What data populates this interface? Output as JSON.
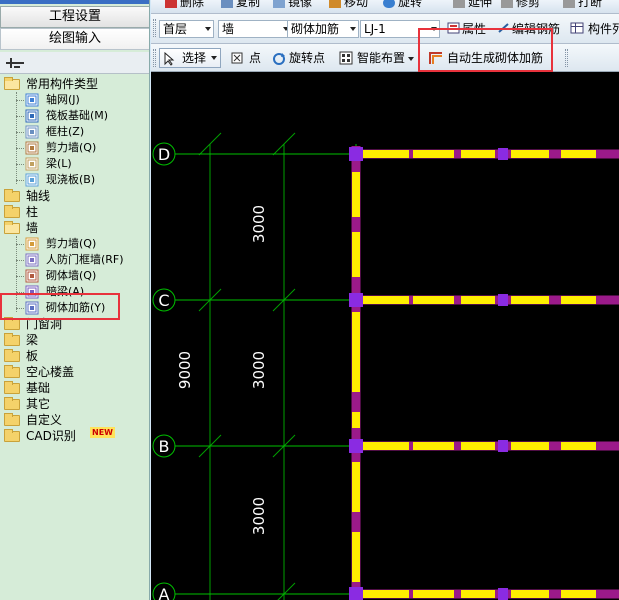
{
  "left_panel": {
    "btn_project_settings": "工程设置",
    "btn_drawing_input": "绘图输入",
    "tree": [
      {
        "label": "常用构件类型",
        "type": "folder-open"
      },
      {
        "label": "轴网(J)",
        "type": "child"
      },
      {
        "label": "筏板基础(M)",
        "type": "child"
      },
      {
        "label": "框柱(Z)",
        "type": "child"
      },
      {
        "label": "剪力墙(Q)",
        "type": "child"
      },
      {
        "label": "梁(L)",
        "type": "child"
      },
      {
        "label": "现浇板(B)",
        "type": "child"
      },
      {
        "label": "轴线",
        "type": "folder"
      },
      {
        "label": "柱",
        "type": "folder"
      },
      {
        "label": "墙",
        "type": "folder-open"
      },
      {
        "label": "剪力墙(Q)",
        "type": "child"
      },
      {
        "label": "人防门框墙(RF)",
        "type": "child"
      },
      {
        "label": "砌体墙(Q)",
        "type": "child"
      },
      {
        "label": "暗梁(A)",
        "type": "child"
      },
      {
        "label": "砌体加筋(Y)",
        "type": "child"
      },
      {
        "label": "门窗洞",
        "type": "folder"
      },
      {
        "label": "梁",
        "type": "folder"
      },
      {
        "label": "板",
        "type": "folder"
      },
      {
        "label": "空心楼盖",
        "type": "folder"
      },
      {
        "label": "基础",
        "type": "folder"
      },
      {
        "label": "其它",
        "type": "folder"
      },
      {
        "label": "自定义",
        "type": "folder"
      },
      {
        "label": "CAD识别",
        "type": "folder"
      }
    ],
    "new_badge": "NEW"
  },
  "toolbar_top": {
    "delete": "删除",
    "copy": "复制",
    "mirror": "镜像",
    "move": "移动",
    "rotate": "旋转",
    "extend": "延伸",
    "trim": "修剪",
    "break": "打断"
  },
  "toolbar_1": {
    "floor": "首层",
    "category": "墙",
    "component_type": "砌体加筋",
    "component_name": "LJ-1",
    "properties": "属性",
    "edit_rebar": "编辑钢筋",
    "component_list": "构件列"
  },
  "toolbar_2": {
    "select": "选择",
    "point": "点",
    "rotate_point": "旋转点",
    "smart_layout": "智能布置",
    "auto_generate": "自动生成砌体加筋"
  },
  "canvas": {
    "axes": [
      "D",
      "C",
      "B",
      "A"
    ],
    "dims": [
      "3000",
      "3000",
      "3000"
    ],
    "total_dim": "9000",
    "colors": {
      "background": "#000000",
      "axis_line": "#00c000",
      "wall": "#9b1a8a",
      "rebar": "#ffee00",
      "node": "#8a2be2"
    }
  }
}
